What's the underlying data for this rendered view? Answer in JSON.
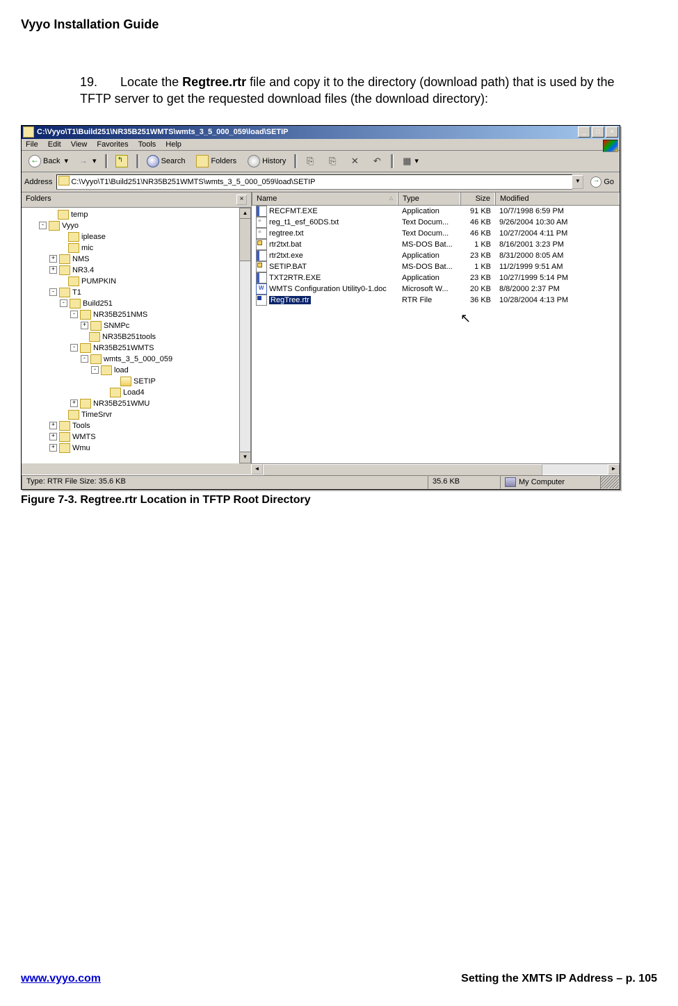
{
  "doc": {
    "header": "Vyyo Installation Guide",
    "step_number": "19.",
    "step_text_pre": "Locate the ",
    "step_bold": "Regtree.rtr",
    "step_text_post": " file and copy it to the directory (download path) that is used by the TFTP server to get the requested download files (the download directory):",
    "figure_caption": "Figure 7-3. Regtree.rtr Location in TFTP Root Directory",
    "footer_url": "www.vyyo.com",
    "footer_right": "Setting the XMTS IP Address – p. 105"
  },
  "win": {
    "title": "C:\\Vyyo\\T1\\Build251\\NR35B251WMTS\\wmts_3_5_000_059\\load\\SETIP",
    "menu": [
      "File",
      "Edit",
      "View",
      "Favorites",
      "Tools",
      "Help"
    ],
    "toolbar": {
      "back": "Back",
      "search": "Search",
      "folders": "Folders",
      "history": "History"
    },
    "address_label": "Address",
    "address_value": "C:\\Vyyo\\T1\\Build251\\NR35B251WMTS\\wmts_3_5_000_059\\load\\SETIP",
    "go": "Go",
    "folders_header": "Folders",
    "columns": {
      "name": "Name",
      "type": "Type",
      "size": "Size",
      "mod": "Modified"
    },
    "status": {
      "left": "Type: RTR File Size: 35.6 KB",
      "mid": "35.6 KB",
      "right": "My Computer"
    }
  },
  "tree": [
    {
      "indent": 40,
      "pm": "",
      "open": false,
      "label": "temp"
    },
    {
      "indent": 25,
      "pm": "-",
      "open": false,
      "label": "Vyyo"
    },
    {
      "indent": 55,
      "pm": "",
      "open": false,
      "label": "iplease"
    },
    {
      "indent": 55,
      "pm": "",
      "open": false,
      "label": "mic"
    },
    {
      "indent": 40,
      "pm": "+",
      "open": false,
      "label": "NMS"
    },
    {
      "indent": 40,
      "pm": "+",
      "open": false,
      "label": "NR3.4"
    },
    {
      "indent": 55,
      "pm": "",
      "open": false,
      "label": "PUMPKIN"
    },
    {
      "indent": 40,
      "pm": "-",
      "open": false,
      "label": "T1"
    },
    {
      "indent": 55,
      "pm": "-",
      "open": false,
      "label": "Build251"
    },
    {
      "indent": 70,
      "pm": "-",
      "open": false,
      "label": "NR35B251NMS"
    },
    {
      "indent": 85,
      "pm": "+",
      "open": false,
      "label": "SNMPc"
    },
    {
      "indent": 85,
      "pm": "",
      "open": false,
      "label": "NR35B251tools"
    },
    {
      "indent": 70,
      "pm": "-",
      "open": false,
      "label": "NR35B251WMTS"
    },
    {
      "indent": 85,
      "pm": "-",
      "open": false,
      "label": "wmts_3_5_000_059"
    },
    {
      "indent": 100,
      "pm": "-",
      "open": false,
      "label": "load"
    },
    {
      "indent": 130,
      "pm": "",
      "open": true,
      "label": "SETIP"
    },
    {
      "indent": 115,
      "pm": "",
      "open": false,
      "label": "Load4"
    },
    {
      "indent": 70,
      "pm": "+",
      "open": false,
      "label": "NR35B251WMU"
    },
    {
      "indent": 55,
      "pm": "",
      "open": false,
      "label": "TimeSrvr"
    },
    {
      "indent": 40,
      "pm": "+",
      "open": false,
      "label": "Tools"
    },
    {
      "indent": 40,
      "pm": "+",
      "open": false,
      "label": "WMTS"
    },
    {
      "indent": 40,
      "pm": "+",
      "open": false,
      "label": "Wmu"
    }
  ],
  "files": [
    {
      "icon": "exe",
      "name": "RECFMT.EXE",
      "type": "Application",
      "size": "91 KB",
      "mod": "10/7/1998 6:59 PM",
      "sel": false
    },
    {
      "icon": "txt",
      "name": "reg_t1_esf_60DS.txt",
      "type": "Text Docum...",
      "size": "46 KB",
      "mod": "9/26/2004 10:30 AM",
      "sel": false
    },
    {
      "icon": "txt",
      "name": "regtree.txt",
      "type": "Text Docum...",
      "size": "46 KB",
      "mod": "10/27/2004 4:11 PM",
      "sel": false
    },
    {
      "icon": "bat",
      "name": "rtr2txt.bat",
      "type": "MS-DOS Bat...",
      "size": "1 KB",
      "mod": "8/16/2001 3:23 PM",
      "sel": false
    },
    {
      "icon": "exe",
      "name": "rtr2txt.exe",
      "type": "Application",
      "size": "23 KB",
      "mod": "8/31/2000 8:05 AM",
      "sel": false
    },
    {
      "icon": "bat",
      "name": "SETIP.BAT",
      "type": "MS-DOS Bat...",
      "size": "1 KB",
      "mod": "11/2/1999 9:51 AM",
      "sel": false
    },
    {
      "icon": "exe",
      "name": "TXT2RTR.EXE",
      "type": "Application",
      "size": "23 KB",
      "mod": "10/27/1999 5:14 PM",
      "sel": false
    },
    {
      "icon": "doc",
      "name": "WMTS Configuration Utility0-1.doc",
      "type": "Microsoft W...",
      "size": "20 KB",
      "mod": "8/8/2000 2:37 PM",
      "sel": false
    },
    {
      "icon": "rtr",
      "name": "RegTree.rtr",
      "type": "RTR File",
      "size": "36 KB",
      "mod": "10/28/2004 4:13 PM",
      "sel": true
    }
  ]
}
